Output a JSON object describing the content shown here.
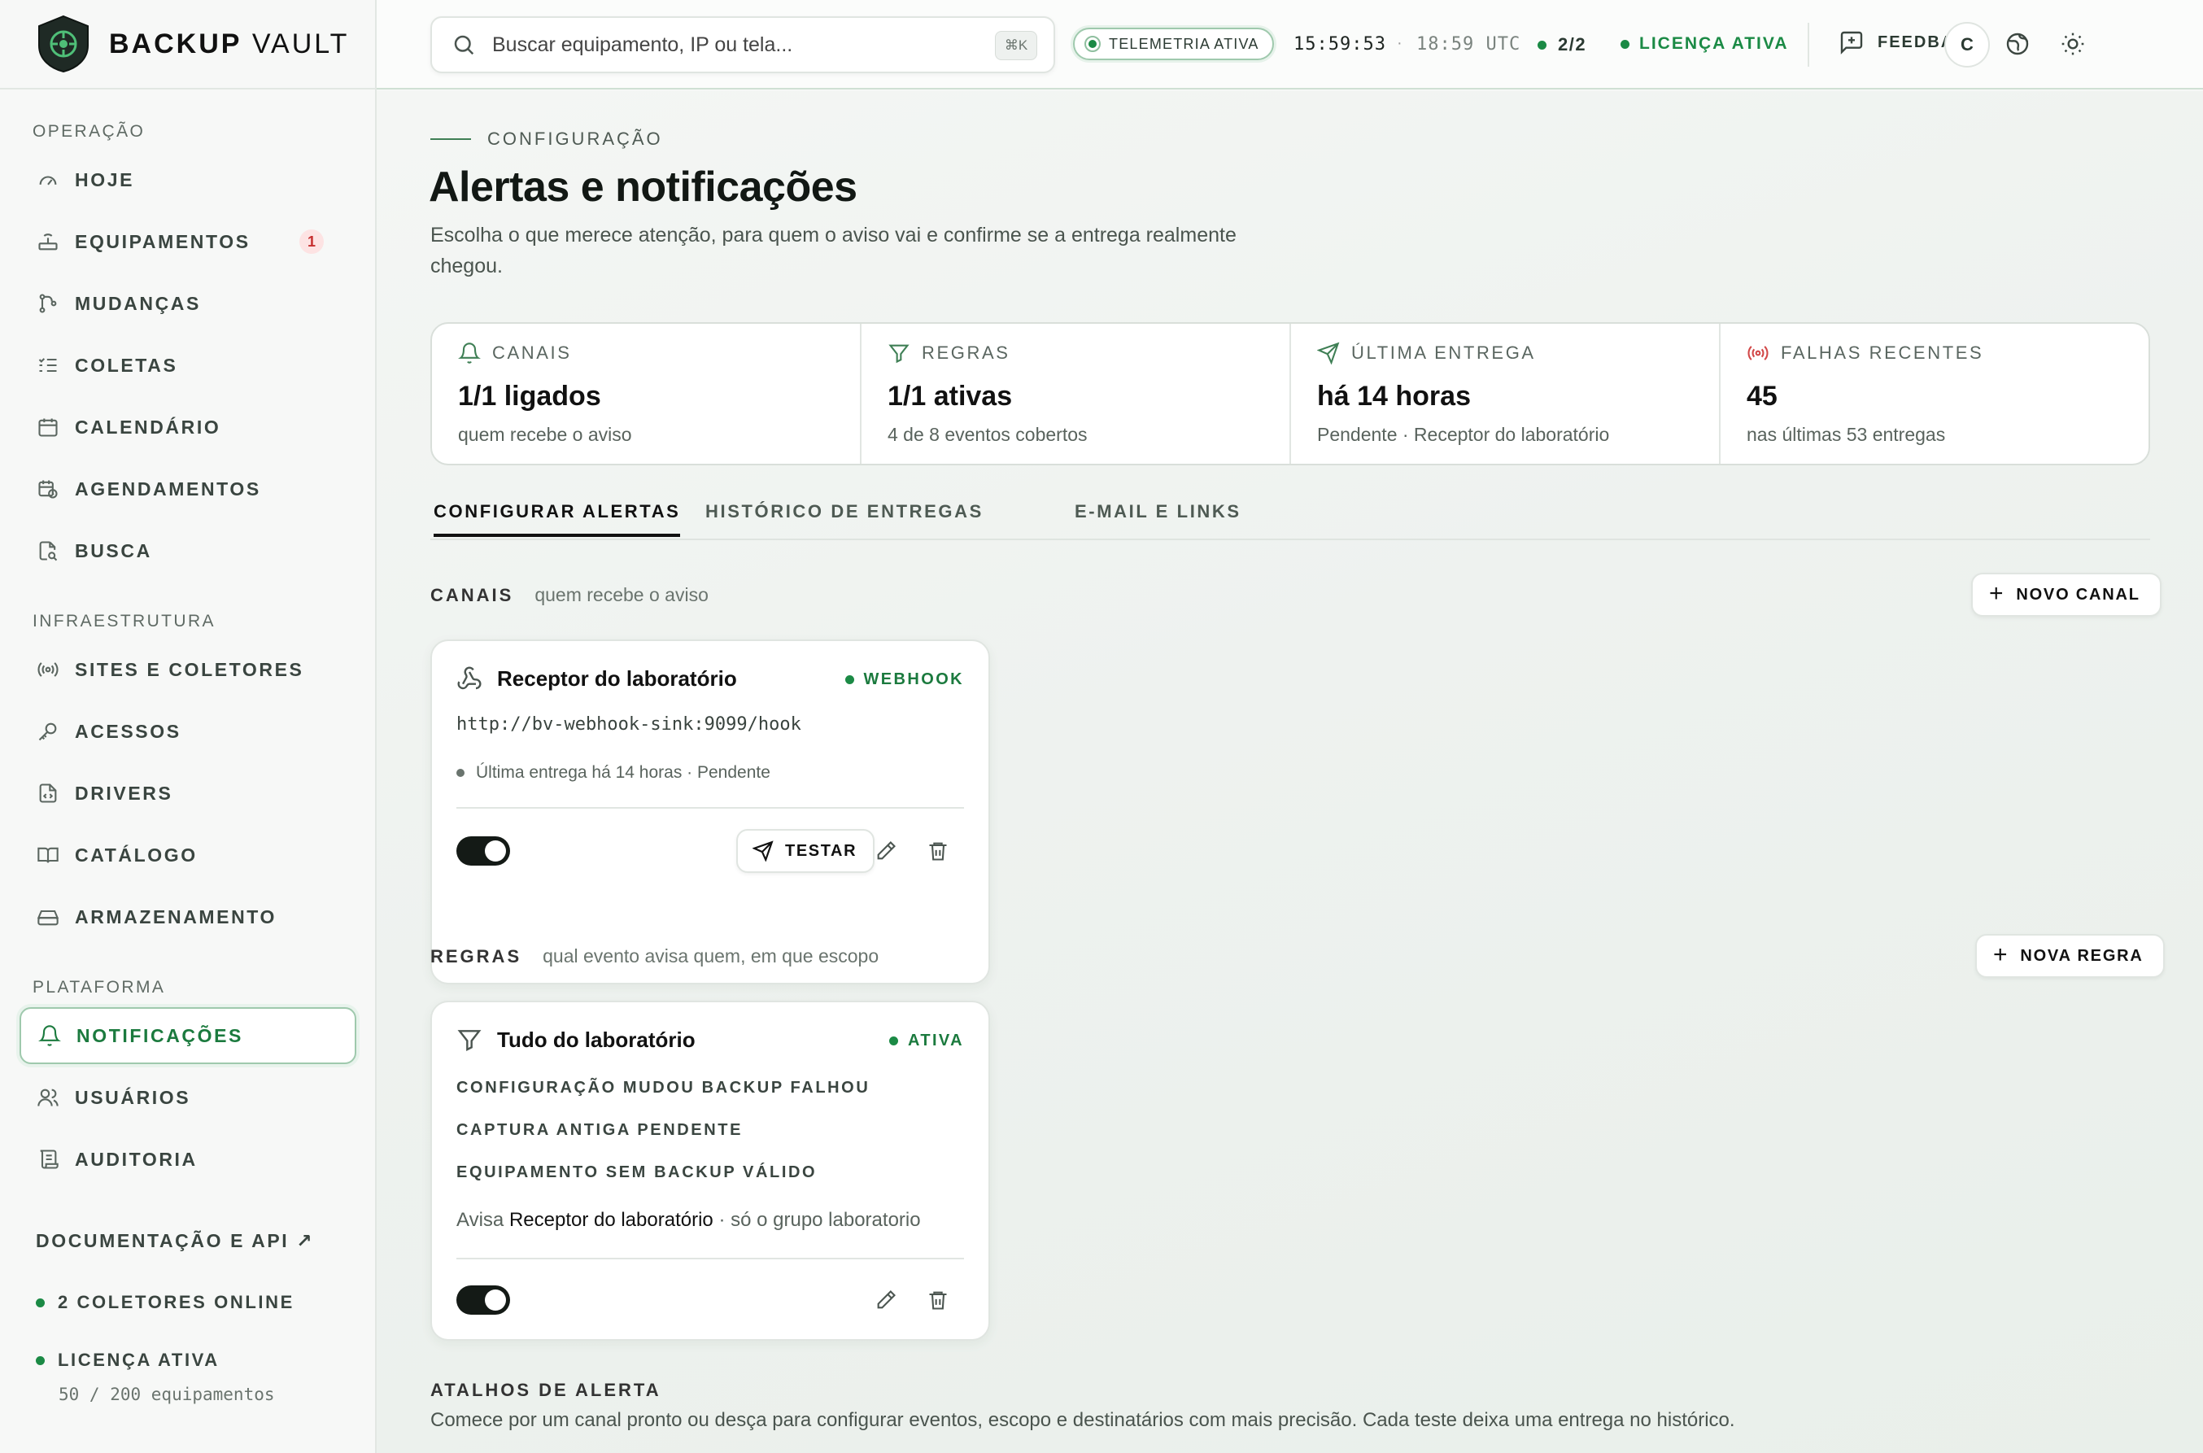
{
  "brand": {
    "name_bold": "BACKUP",
    "name_light": "VAULT"
  },
  "sidebar": {
    "sections": {
      "operacao": "OPERAÇÃO",
      "infra": "INFRAESTRUTURA",
      "plataforma": "PLATAFORMA"
    },
    "items": [
      {
        "label": "HOJE",
        "icon": "gauge-icon"
      },
      {
        "label": "EQUIPAMENTOS",
        "icon": "router-icon",
        "badge": "1"
      },
      {
        "label": "MUDANÇAS",
        "icon": "git-branch-icon"
      },
      {
        "label": "COLETAS",
        "icon": "list-check-icon"
      },
      {
        "label": "CALENDÁRIO",
        "icon": "calendar-icon"
      },
      {
        "label": "AGENDAMENTOS",
        "icon": "calendar-clock-icon"
      },
      {
        "label": "BUSCA",
        "icon": "file-search-icon"
      },
      {
        "label": "SITES E COLETORES",
        "icon": "radio-icon"
      },
      {
        "label": "ACESSOS",
        "icon": "key-icon"
      },
      {
        "label": "DRIVERS",
        "icon": "file-code-icon"
      },
      {
        "label": "CATÁLOGO",
        "icon": "book-icon"
      },
      {
        "label": "ARMAZENAMENTO",
        "icon": "hard-drive-icon"
      },
      {
        "label": "NOTIFICAÇÕES",
        "icon": "bell-icon",
        "active": true
      },
      {
        "label": "USUÁRIOS",
        "icon": "users-icon"
      },
      {
        "label": "AUDITORIA",
        "icon": "scroll-icon"
      }
    ],
    "docs_link": "DOCUMENTAÇÃO E API ↗",
    "collectors_online": "2 COLETORES ONLINE",
    "license_status": "LICENÇA ATIVA",
    "license_usage": "50 / 200 equipamentos"
  },
  "topbar": {
    "search_placeholder": "Buscar equipamento, IP ou tela...",
    "search_shortcut": "⌘K",
    "telemetry": "TELEMETRIA ATIVA",
    "time_local": "15:59:53",
    "time_sep": "·",
    "time_utc": "18:59 UTC",
    "collectors": "2/2",
    "license": "LICENÇA ATIVA",
    "feedback": "FEEDBACK",
    "avatar_initial": "C"
  },
  "page": {
    "eyebrow": "CONFIGURAÇÃO",
    "title": "Alertas e notificações",
    "description": "Escolha o que merece atenção, para quem o aviso vai e confirme se a entrega realmente chegou."
  },
  "stats": [
    {
      "label": "CANAIS",
      "value": "1/1 ligados",
      "sub": "quem recebe o aviso",
      "icon": "bell-icon"
    },
    {
      "label": "REGRAS",
      "value": "1/1 ativas",
      "sub": "4 de 8 eventos cobertos",
      "icon": "filter-icon"
    },
    {
      "label": "ÚLTIMA ENTREGA",
      "value": "há 14 horas",
      "sub": "Pendente · Receptor do laboratório",
      "icon": "send-icon"
    },
    {
      "label": "FALHAS RECENTES",
      "value": "45",
      "sub": "nas últimas 53 entregas",
      "icon": "radio-alert-icon"
    }
  ],
  "tabs": [
    {
      "label": "CONFIGURAR ALERTAS",
      "active": true
    },
    {
      "label": "HISTÓRICO DE ENTREGAS"
    },
    {
      "label": "E-MAIL E LINKS"
    }
  ],
  "channels": {
    "title": "CANAIS",
    "subtitle": "quem recebe o aviso",
    "new_button": "NOVO CANAL",
    "card": {
      "name": "Receptor do laboratório",
      "type": "WEBHOOK",
      "url": "http://bv-webhook-sink:9099/hook",
      "last_delivery": "Última entrega há 14 horas · Pendente",
      "enabled": true,
      "test_button": "TESTAR"
    }
  },
  "rules": {
    "title": "REGRAS",
    "subtitle": "qual evento avisa quem, em que escopo",
    "new_button": "NOVA REGRA",
    "card": {
      "name": "Tudo do laboratório",
      "status": "ATIVA",
      "events_line1": "CONFIGURAÇÃO MUDOU  BACKUP FALHOU",
      "events_line2": "CAPTURA ANTIGA PENDENTE",
      "events_line3": "EQUIPAMENTO SEM BACKUP VÁLIDO",
      "notify_prefix": "Avisa",
      "notify_target": "Receptor do laboratório",
      "notify_scope": "· só o grupo laboratorio",
      "enabled": true
    }
  },
  "shortcuts": {
    "title": "ATALHOS DE ALERTA",
    "description": "Comece por um canal pronto ou desça para configurar eventos, escopo e destinatários com mais precisão. Cada teste deixa uma entrega no histórico."
  },
  "colors": {
    "accent": "#1b7a3e",
    "danger": "#d24848",
    "dark": "#141a16"
  }
}
